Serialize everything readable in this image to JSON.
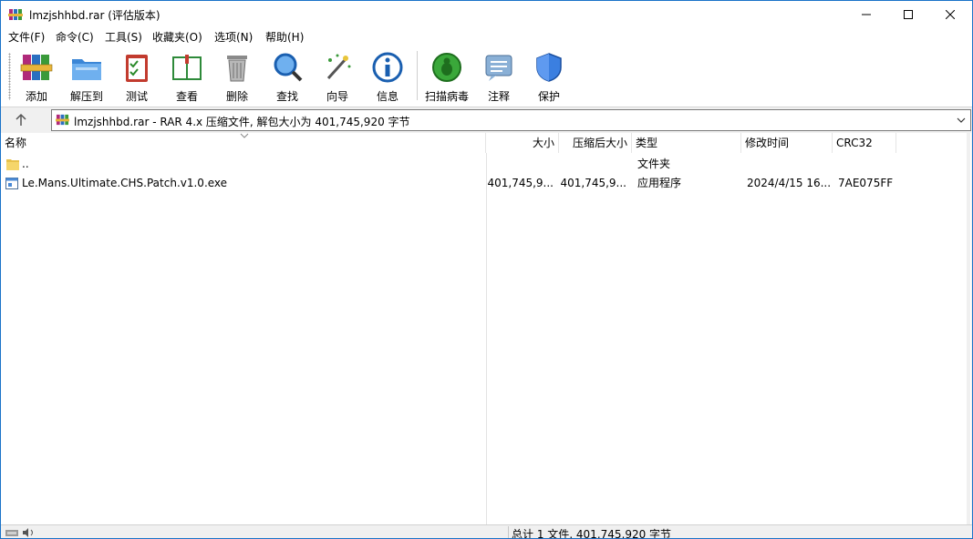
{
  "window": {
    "title": "lmzjshhbd.rar (评估版本)"
  },
  "menu": [
    "文件(F)",
    "命令(C)",
    "工具(S)",
    "收藏夹(O)",
    "选项(N)",
    "帮助(H)"
  ],
  "toolbar": {
    "buttons": [
      {
        "label": "添加",
        "icon": "books-add-icon"
      },
      {
        "label": "解压到",
        "icon": "folder-extract-icon"
      },
      {
        "label": "测试",
        "icon": "clipboard-test-icon"
      },
      {
        "label": "查看",
        "icon": "book-view-icon"
      },
      {
        "label": "删除",
        "icon": "trash-icon"
      },
      {
        "label": "查找",
        "icon": "magnifier-icon"
      },
      {
        "label": "向导",
        "icon": "magic-wand-icon"
      },
      {
        "label": "信息",
        "icon": "info-icon"
      },
      {
        "label": "扫描病毒",
        "icon": "virus-scan-icon"
      },
      {
        "label": "注释",
        "icon": "comment-icon"
      },
      {
        "label": "保护",
        "icon": "shield-icon"
      }
    ]
  },
  "address": {
    "text": "lmzjshhbd.rar - RAR 4.x 压缩文件, 解包大小为 401,745,920 字节"
  },
  "columns": [
    "名称",
    "大小",
    "压缩后大小",
    "类型",
    "修改时间",
    "CRC32"
  ],
  "rows": [
    {
      "name": "..",
      "size": "",
      "packed": "",
      "type": "文件夹",
      "modified": "",
      "crc": ""
    },
    {
      "name": "Le.Mans.Ultimate.CHS.Patch.v1.0.exe",
      "size": "401,745,9...",
      "packed": "401,745,9...",
      "type": "应用程序",
      "modified": "2024/4/15 16...",
      "crc": "7AE075FF"
    }
  ],
  "status": {
    "text": "总计 1 文件, 401,745,920 字节"
  },
  "colors": {
    "accent": "#1a73c8",
    "background": "#f0f0f0"
  }
}
